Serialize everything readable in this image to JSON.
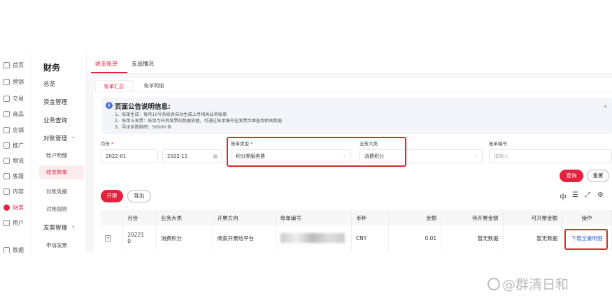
{
  "rail": [
    {
      "label": "首页",
      "icon": "home-icon"
    },
    {
      "label": "营销",
      "icon": "tag-icon"
    },
    {
      "label": "交易",
      "icon": "trade-icon"
    },
    {
      "label": "商品",
      "icon": "goods-icon"
    },
    {
      "label": "店铺",
      "icon": "store-icon"
    },
    {
      "label": "推广",
      "icon": "promote-icon"
    },
    {
      "label": "物流",
      "icon": "truck-icon"
    },
    {
      "label": "客服",
      "icon": "service-icon"
    },
    {
      "label": "内容",
      "icon": "content-icon"
    },
    {
      "label": "财务",
      "icon": "finance-icon",
      "active": true
    },
    {
      "label": "用户",
      "icon": "user-icon"
    },
    {
      "label": "数据",
      "icon": "data-icon"
    }
  ],
  "menu": {
    "title": "财务",
    "overview": "总览",
    "fund": "资金管理",
    "business": "业务查询",
    "reconcile": "对账管理",
    "reconcile_items": [
      "账户明细",
      "收支账单",
      "对账凭据",
      "对账规则"
    ],
    "invoice": "发票管理",
    "invoice_items": [
      "申请发票"
    ]
  },
  "tabs": {
    "income": "收支账单",
    "expense": "支出情况"
  },
  "subtabs": {
    "summary": "账单汇总",
    "detail": "账单明细"
  },
  "notice": {
    "title": "页面公告说明信息:",
    "lines": [
      "1、账单生成：每月10号系统会自动生成上月相关业务账单",
      "2、账单与发票：账单为开具发票的数据依据，可通过账单编号在发票页面查找相关数据",
      "3、导出条数限制：50000 条"
    ],
    "close": "×"
  },
  "filters": {
    "month_label": "月份",
    "month_from": "2022-01",
    "month_to": "2022-11",
    "bill_type_label": "账单类型",
    "bill_type_value": "积分类服务费",
    "category_label": "业务大类",
    "category_value": "消费积分",
    "bill_no_label": "账单编号",
    "bill_no_placeholder": "请输入",
    "required_mark": "*"
  },
  "buttons": {
    "query": "查询",
    "reset": "重置",
    "invoice": "开票",
    "export": "导出"
  },
  "toolbar_icons": [
    "中",
    "☰",
    "⤢",
    "⚙"
  ],
  "table": {
    "headers": [
      "月份",
      "业务大类",
      "开票方向",
      "账单编号",
      "币种",
      "金额",
      "待开票金额",
      "可开票金额",
      "操作"
    ],
    "rows": [
      {
        "month_a": "20221",
        "month_b": "0",
        "category": "消费积分",
        "direction": "商家开票给平台",
        "bill_no": "",
        "currency": "CNY",
        "amount": "0.01",
        "pending": "暂无数据",
        "available": "暂无数据",
        "op": "下载全量明细"
      }
    ],
    "expand": "+"
  },
  "watermark": "@群清日和"
}
